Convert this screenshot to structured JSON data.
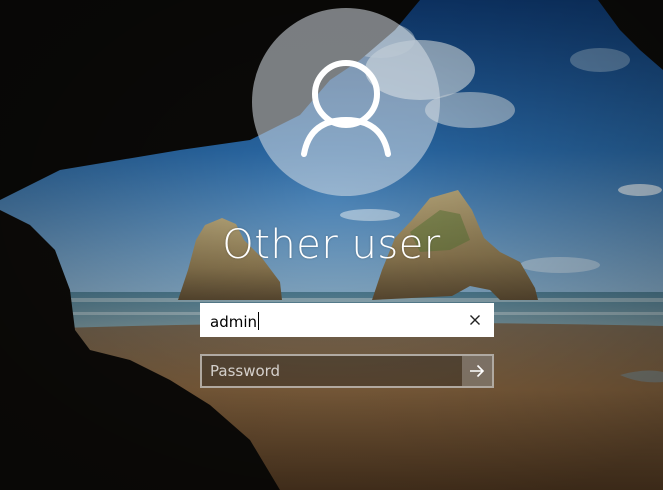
{
  "login": {
    "user_display_name": "Other user",
    "username_value": "admin",
    "password_placeholder": "Password"
  },
  "icons": {
    "avatar": "user-silhouette-icon",
    "clear": "close-icon",
    "submit": "arrow-right-icon"
  },
  "colors": {
    "text": "#ffffff",
    "input_bg": "#ffffff",
    "sky": "#1e5c98",
    "sand": "#8a6a45"
  }
}
